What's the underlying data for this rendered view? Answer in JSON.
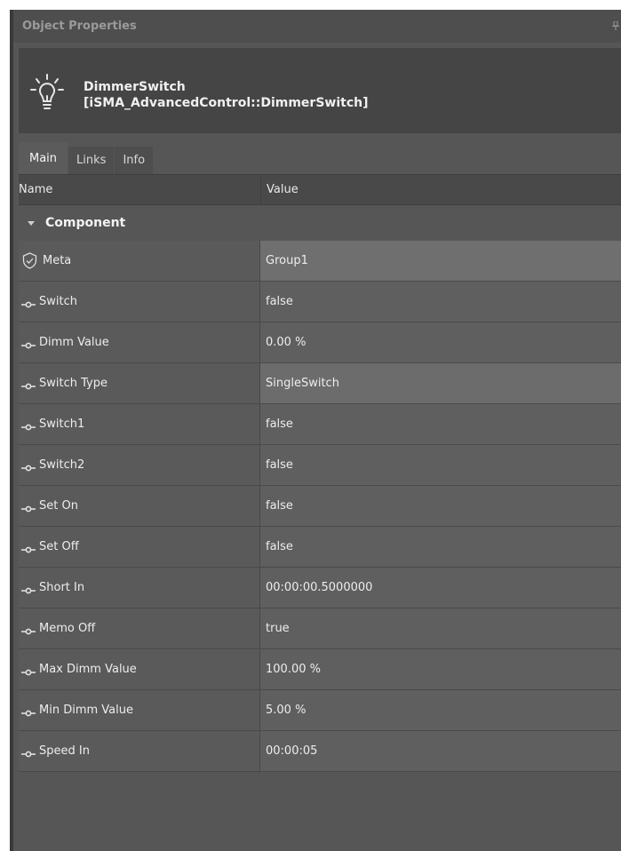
{
  "panel": {
    "title": "Object Properties"
  },
  "object": {
    "name_line1": "DimmerSwitch",
    "name_line2": "[iSMA_AdvancedControl::DimmerSwitch]"
  },
  "tabs": [
    {
      "label": "Main",
      "active": true
    },
    {
      "label": "Links",
      "active": false
    },
    {
      "label": "Info",
      "active": false
    }
  ],
  "table": {
    "col_name": "Name",
    "col_value": "Value",
    "group_label": "Component",
    "rows": [
      {
        "name": "Meta",
        "value": "Group1",
        "icon": "shield-check-icon"
      },
      {
        "name": "Switch",
        "value": "false",
        "icon": "slot-icon"
      },
      {
        "name": "Dimm Value",
        "value": "0.00 %",
        "icon": "slot-icon"
      },
      {
        "name": "Switch Type",
        "value": "SingleSwitch",
        "icon": "slot-icon"
      },
      {
        "name": "Switch1",
        "value": "false",
        "icon": "slot-icon"
      },
      {
        "name": "Switch2",
        "value": "false",
        "icon": "slot-icon"
      },
      {
        "name": "Set On",
        "value": "false",
        "icon": "slot-icon"
      },
      {
        "name": "Set Off",
        "value": "false",
        "icon": "slot-icon"
      },
      {
        "name": "Short In",
        "value": "00:00:00.5000000",
        "icon": "slot-icon"
      },
      {
        "name": "Memo Off",
        "value": "true",
        "icon": "slot-icon"
      },
      {
        "name": "Max Dimm Value",
        "value": "100.00 %",
        "icon": "slot-icon"
      },
      {
        "name": "Min Dimm Value",
        "value": "5.00 %",
        "icon": "slot-icon"
      },
      {
        "name": "Speed In",
        "value": "00:00:05",
        "icon": "slot-icon"
      }
    ]
  }
}
